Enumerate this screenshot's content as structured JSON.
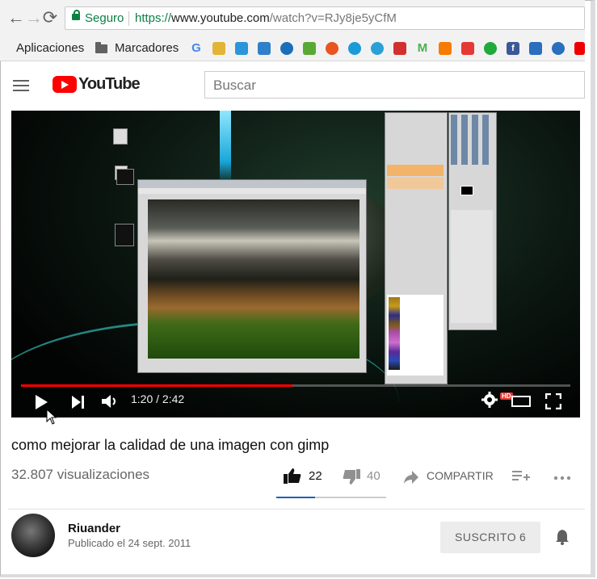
{
  "browser": {
    "secure_label": "Seguro",
    "url_scheme": "https://",
    "url_host": "www.youtube.com",
    "url_path": "/watch?v=RJy8je5yCfM"
  },
  "bookmarks": {
    "apps_label": "Aplicaciones",
    "folder_label": "Marcadores",
    "icons": [
      "google-icon",
      "bookmark-2-icon",
      "bookmark-3-icon",
      "bookmark-4-icon",
      "bookmark-5-icon",
      "bookmark-6-icon",
      "ubuntu-icon",
      "bookmark-8-icon",
      "bookmark-9-icon",
      "bookmark-10-icon",
      "bookmark-11-icon",
      "bookmark-12-icon",
      "bookmark-13-icon",
      "bookmark-14-icon",
      "facebook-icon",
      "calendar-icon",
      "account-icon",
      "youtube-icon"
    ]
  },
  "youtube": {
    "logo_text": "YouTube",
    "search_placeholder": "Buscar"
  },
  "player": {
    "current_time": "1:20",
    "duration": "2:42",
    "time_display": "1:20 / 2:42",
    "progress_fraction": 0.494,
    "hd_badge": "HD"
  },
  "video": {
    "title": "como mejorar la calidad de una imagen con gimp",
    "views": "32.807 visualizaciones",
    "likes": "22",
    "dislikes": "40",
    "share_label": "COMPARTIR",
    "like_fraction": 0.355
  },
  "channel": {
    "name": "Riuander",
    "published": "Publicado el 24 sept. 2011",
    "subscribe_label": "SUSCRITO",
    "subscriber_count": "6"
  },
  "colors": {
    "youtube_red": "#ff0000",
    "secure_green": "#0b8043",
    "like_blue": "#1c62b9"
  }
}
